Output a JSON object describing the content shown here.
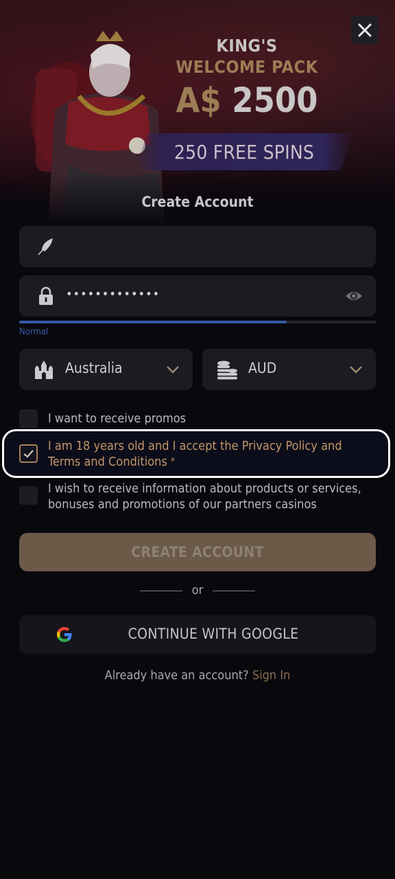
{
  "banner": {
    "line1": "KING'S",
    "line2": "WELCOME PACK",
    "currency": "A$",
    "amount": "2500",
    "spins": "250 FREE SPINS"
  },
  "form": {
    "title": "Create Account",
    "username_value": "",
    "password_value": "•••••••••••••",
    "strength_label": "Normal",
    "strength_fraction": 0.75,
    "country": "Australia",
    "currency": "AUD"
  },
  "checkboxes": {
    "promos": {
      "text": "I want to receive promos",
      "checked": false
    },
    "terms": {
      "text": "I am 18 years old and I accept the Privacy Policy and Terms and Conditions",
      "required": "*",
      "checked": true
    },
    "partners": {
      "text": "I wish to receive information about products or services, bonuses and promotions of our partners casinos",
      "checked": false
    }
  },
  "buttons": {
    "create": "CREATE ACCOUNT",
    "or": "or",
    "google": "CONTINUE WITH GOOGLE"
  },
  "footer": {
    "question": "Already have an account?",
    "signin": "Sign In"
  },
  "icons": {
    "close": "close-icon",
    "username": "feather-icon",
    "password": "lock-icon",
    "show_password": "eye-icon",
    "country": "castle-icon",
    "currency": "coins-icon",
    "dropdown": "chevron-down-icon",
    "google": "google-icon"
  },
  "colors": {
    "accent_gold": "#9c7d55",
    "strength_blue": "#3559a7",
    "checkbox_text_active": "#c2976a",
    "button_disabled": "#6b5a48"
  }
}
